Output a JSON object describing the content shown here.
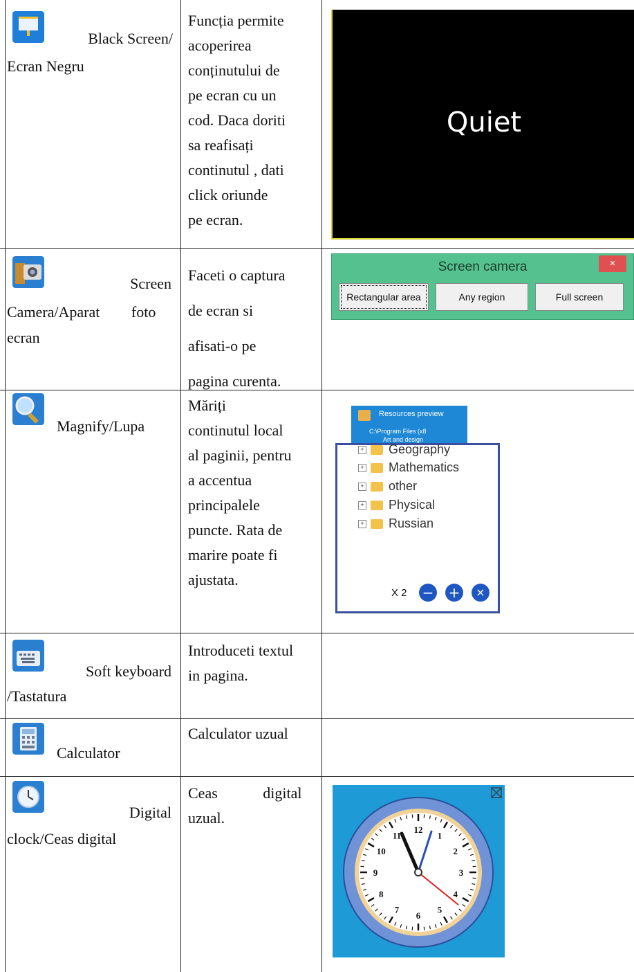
{
  "rows": [
    {
      "name": "Black Screen/ Ecran Negru",
      "name_lines": [
        "Black Screen/",
        "Ecran Negru"
      ],
      "desc_lines": [
        "Funcția permite",
        "acoperirea",
        "conținutului de",
        "pe ecran cu un",
        "cod. Daca doriti",
        "sa reafisați",
        "continutul , dati",
        "click oriunde",
        "pe ecran."
      ],
      "icon": "projector-screen-icon"
    },
    {
      "name_lines": [
        "Screen",
        "Camera/Aparat foto",
        "ecran"
      ],
      "desc_lines": [
        "Faceti o captura",
        "de ecran si",
        "afisati-o pe",
        "pagina curenta."
      ],
      "icon": "camera-icon"
    },
    {
      "name_lines": [
        "Magnify/Lupa"
      ],
      "desc_lines": [
        "Măriți",
        "continutul local",
        "al paginii, pentru",
        "a accentua",
        "principalele",
        "puncte. Rata de",
        "marire poate fi",
        "ajustata."
      ],
      "icon": "magnifier-icon"
    },
    {
      "name_lines": [
        "Soft keyboard",
        "/Tastatura"
      ],
      "desc_lines": [
        "Introduceti textul",
        "in pagina."
      ],
      "icon": "keyboard-icon"
    },
    {
      "name_lines": [
        "Calculator"
      ],
      "desc_lines": [
        "Calculator uzual"
      ],
      "icon": "calculator-icon"
    },
    {
      "name_lines": [
        "Digital",
        "clock/Ceas digital"
      ],
      "desc_lines": [
        "Ceas digital",
        "uzual."
      ],
      "icon": "clock-icon"
    }
  ],
  "black_screen": {
    "text": "Quiet"
  },
  "screen_camera": {
    "title": "Screen camera",
    "close": "×",
    "buttons": [
      "Rectangular area",
      "Any region",
      "Full screen"
    ]
  },
  "magnify": {
    "header": "Resources preview",
    "path": "C:\\Program Files (x8",
    "sub": "Art and design",
    "items": [
      "Geography",
      "Mathematics",
      "other",
      "Physical",
      "Russian"
    ],
    "zoom": "X 2"
  },
  "clock": {
    "numbers": [
      "12",
      "1",
      "2",
      "3",
      "4",
      "5",
      "6",
      "7",
      "8",
      "9",
      "10",
      "11"
    ]
  }
}
